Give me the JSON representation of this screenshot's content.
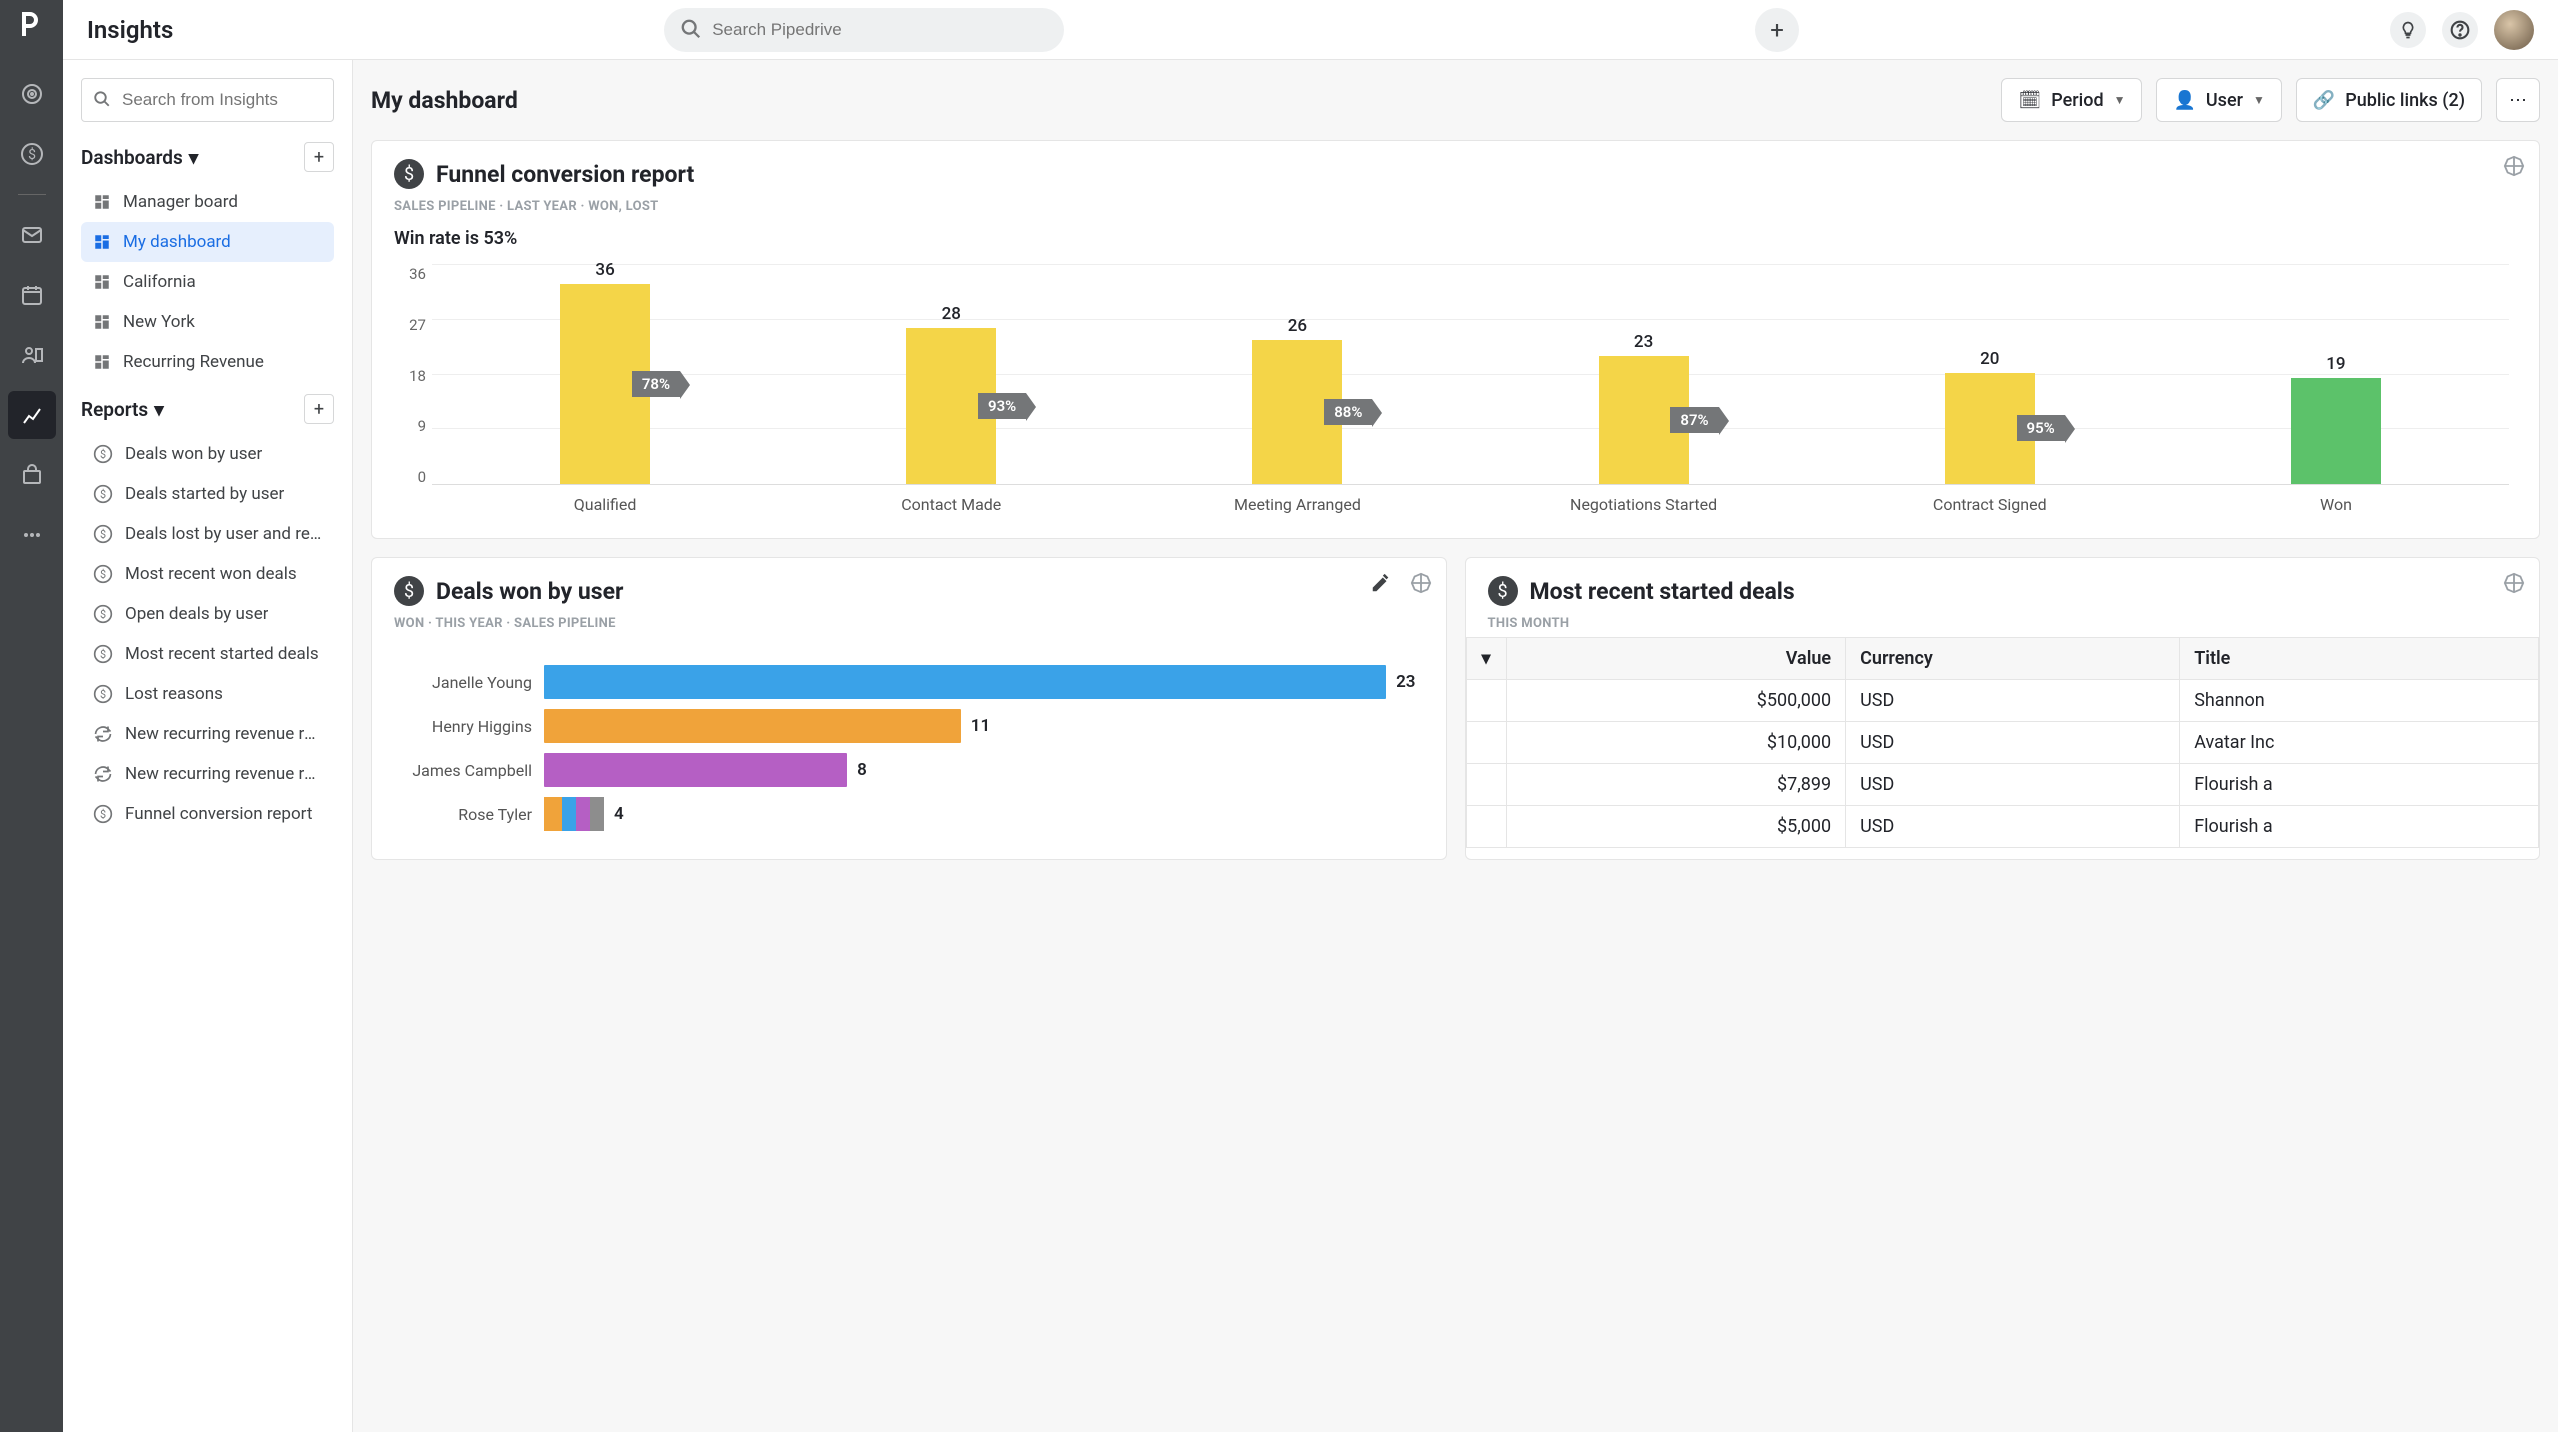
{
  "header": {
    "title": "Insights",
    "search_placeholder": "Search Pipedrive"
  },
  "sidebar": {
    "search_placeholder": "Search from Insights",
    "dashboards_label": "Dashboards",
    "reports_label": "Reports",
    "dashboards": [
      {
        "label": "Manager board"
      },
      {
        "label": "My dashboard",
        "active": true
      },
      {
        "label": "California"
      },
      {
        "label": "New York"
      },
      {
        "label": "Recurring Revenue"
      }
    ],
    "reports": [
      {
        "label": "Deals won by user",
        "icon": "dollar"
      },
      {
        "label": "Deals started by user",
        "icon": "dollar"
      },
      {
        "label": "Deals lost by user and rea…",
        "icon": "dollar"
      },
      {
        "label": "Most recent won deals",
        "icon": "dollar"
      },
      {
        "label": "Open deals by user",
        "icon": "dollar"
      },
      {
        "label": "Most recent started deals",
        "icon": "dollar"
      },
      {
        "label": "Lost reasons",
        "icon": "dollar"
      },
      {
        "label": "New recurring revenue re…",
        "icon": "recur"
      },
      {
        "label": "New recurring revenue re…",
        "icon": "recur"
      },
      {
        "label": "Funnel conversion report",
        "icon": "dollar"
      }
    ]
  },
  "topbar": {
    "title": "My dashboard",
    "period": "Period",
    "user": "User",
    "public_links": "Public links (2)"
  },
  "funnel": {
    "title": "Funnel conversion report",
    "meta": "SALES PIPELINE  ·  LAST YEAR  ·  WON, LOST",
    "subtitle": "Win rate is 53%"
  },
  "chart_data": [
    {
      "id": "funnel",
      "type": "bar",
      "title": "Funnel conversion report",
      "categories": [
        "Qualified",
        "Contact Made",
        "Meeting Arranged",
        "Negotiations Started",
        "Contract Signed",
        "Won"
      ],
      "values": [
        36,
        28,
        26,
        23,
        20,
        19
      ],
      "conversion_labels": [
        "78%",
        "93%",
        "88%",
        "87%",
        "95%"
      ],
      "y_ticks": [
        0,
        9,
        18,
        27,
        36
      ],
      "ylim": [
        0,
        36
      ],
      "won_index": 5,
      "bar_color": "#f4d548",
      "won_color": "#5cc26a"
    },
    {
      "id": "deals_won",
      "type": "hbar",
      "title": "Deals won by user",
      "categories": [
        "Janelle Young",
        "Henry Higgins",
        "James Campbell",
        "Rose Tyler"
      ],
      "values": [
        23,
        11,
        8,
        4
      ],
      "colors": [
        "#3aa2e8",
        "#f0a33a",
        "#b55fc4",
        "multi"
      ],
      "multi_segments": [
        {
          "color": "#f0a33a",
          "w": 18
        },
        {
          "color": "#3aa2e8",
          "w": 14
        },
        {
          "color": "#b55fc4",
          "w": 14
        },
        {
          "color": "#8d8d8d",
          "w": 14
        }
      ],
      "xlim": [
        0,
        23
      ]
    }
  ],
  "deals_won": {
    "title": "Deals won by user",
    "meta": "WON  ·  THIS YEAR  ·  SALES PIPELINE"
  },
  "recent": {
    "title": "Most recent started deals",
    "meta": "THIS MONTH",
    "columns": {
      "value": "Value",
      "currency": "Currency",
      "title": "Title"
    },
    "rows": [
      {
        "value": "$500,000",
        "currency": "USD",
        "title": "Shannon"
      },
      {
        "value": "$10,000",
        "currency": "USD",
        "title": "Avatar Inc"
      },
      {
        "value": "$7,899",
        "currency": "USD",
        "title": "Flourish a"
      },
      {
        "value": "$5,000",
        "currency": "USD",
        "title": "Flourish a"
      }
    ]
  }
}
